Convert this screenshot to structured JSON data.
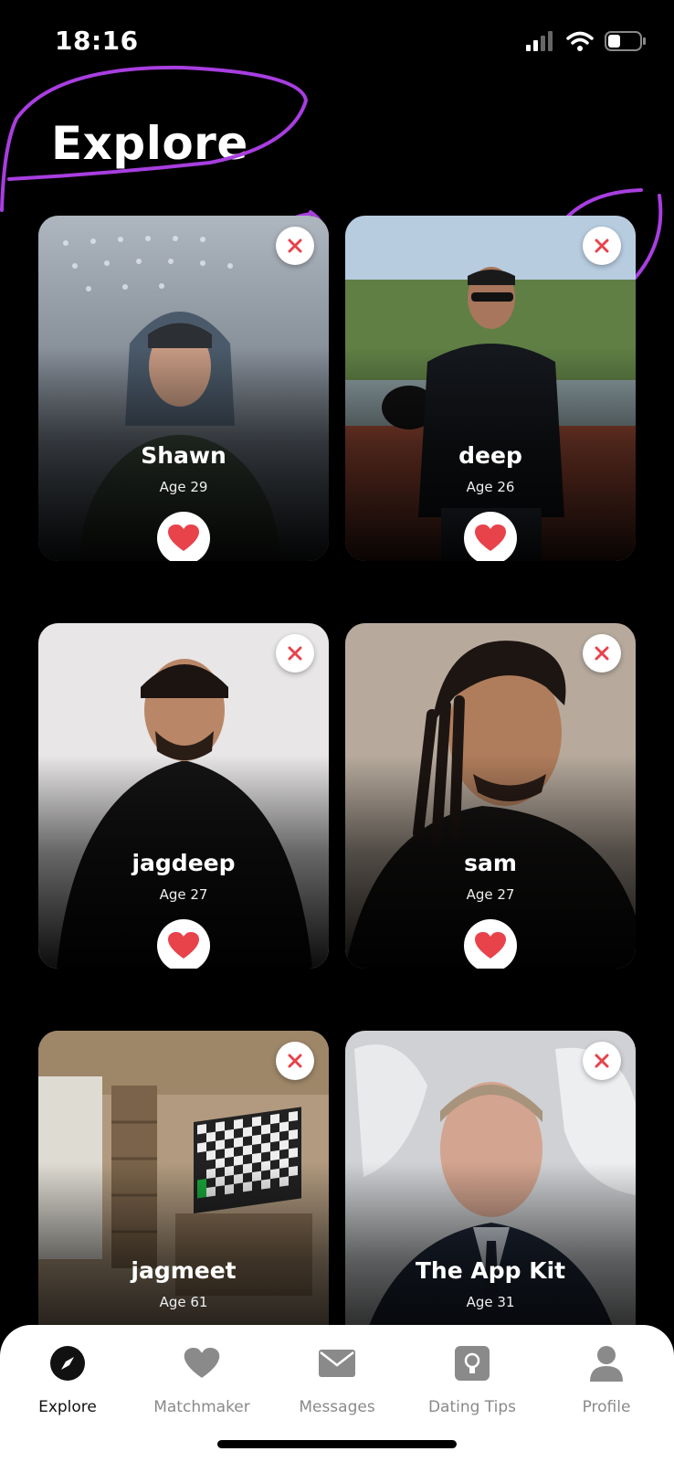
{
  "status": {
    "time": "18:16"
  },
  "page": {
    "title": "Explore"
  },
  "colors": {
    "accent_red": "#e8424b",
    "annotation_purple": "#a83ee0"
  },
  "profiles": [
    {
      "name": "Shawn",
      "age": "Age 29"
    },
    {
      "name": "deep",
      "age": "Age 26"
    },
    {
      "name": "jagdeep",
      "age": "Age 27"
    },
    {
      "name": "sam",
      "age": "Age 27"
    },
    {
      "name": "jagmeet",
      "age": "Age 61"
    },
    {
      "name": "The App Kit",
      "age": "Age 31"
    }
  ],
  "tabs": [
    {
      "label": "Explore",
      "icon": "compass-icon"
    },
    {
      "label": "Matchmaker",
      "icon": "heart-icon"
    },
    {
      "label": "Messages",
      "icon": "envelope-icon"
    },
    {
      "label": "Dating Tips",
      "icon": "lightbulb-icon"
    },
    {
      "label": "Profile",
      "icon": "user-icon"
    }
  ]
}
